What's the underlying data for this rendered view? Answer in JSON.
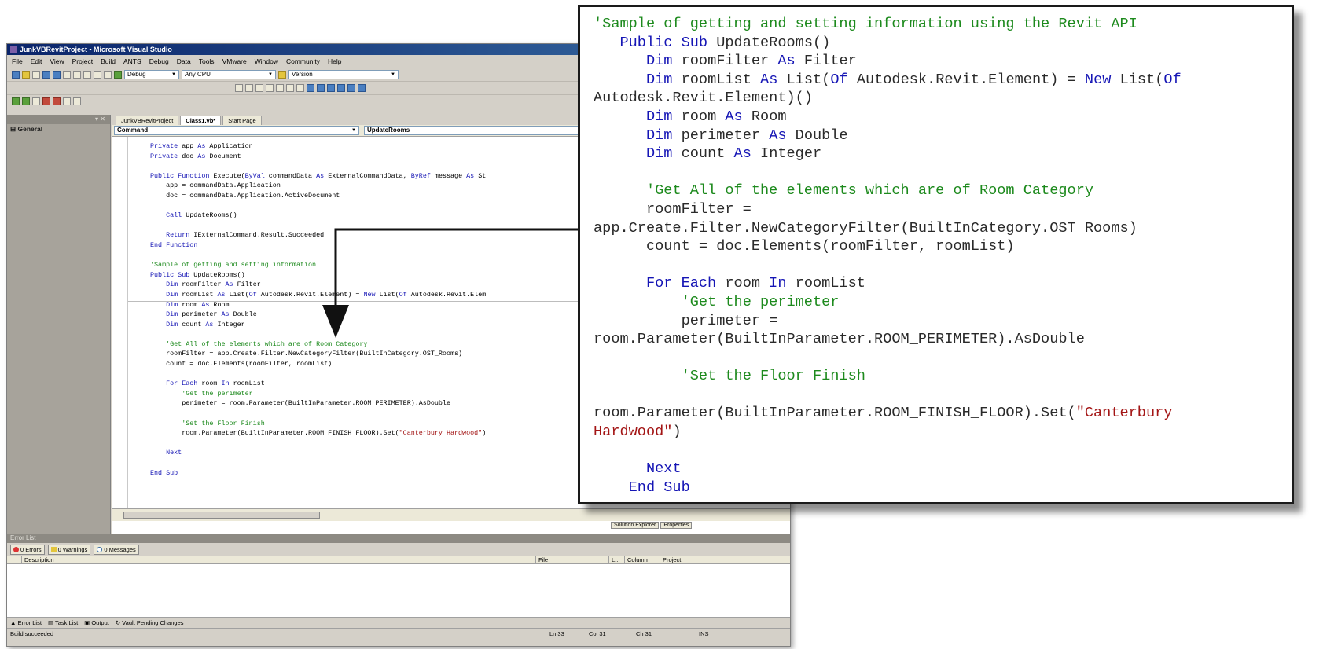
{
  "window": {
    "title": "JunkVBRevitProject - Microsoft Visual Studio"
  },
  "menu": [
    "File",
    "Edit",
    "View",
    "Project",
    "Build",
    "ANTS",
    "Debug",
    "Data",
    "Tools",
    "VMware",
    "Window",
    "Community",
    "Help"
  ],
  "toolbar": {
    "config": "Debug",
    "platform": "Any CPU",
    "version_label": "Version"
  },
  "toolbox": {
    "group": "General"
  },
  "doc_tabs": [
    "JunkVBRevitProject",
    "Class1.vb*",
    "Start Page"
  ],
  "nav": {
    "class_combo": "Command",
    "method_combo": "UpdateRooms"
  },
  "code_lines": [
    {
      "indent": "",
      "parts": [
        {
          "t": "kw",
          "v": "Private"
        },
        {
          "t": "",
          "v": " app "
        },
        {
          "t": "kw",
          "v": "As"
        },
        {
          "t": "",
          "v": " Application"
        }
      ]
    },
    {
      "indent": "",
      "parts": [
        {
          "t": "kw",
          "v": "Private"
        },
        {
          "t": "",
          "v": " doc "
        },
        {
          "t": "kw",
          "v": "As"
        },
        {
          "t": "",
          "v": " Document"
        }
      ]
    },
    {
      "indent": "",
      "parts": []
    },
    {
      "indent": "",
      "parts": [
        {
          "t": "kw",
          "v": "Public Function"
        },
        {
          "t": "",
          "v": " Execute("
        },
        {
          "t": "kw",
          "v": "ByVal"
        },
        {
          "t": "",
          "v": " commandData "
        },
        {
          "t": "kw",
          "v": "As"
        },
        {
          "t": "",
          "v": " ExternalCommandData, "
        },
        {
          "t": "kw",
          "v": "ByRef"
        },
        {
          "t": "",
          "v": " message "
        },
        {
          "t": "kw",
          "v": "As"
        },
        {
          "t": "",
          "v": " St"
        }
      ]
    },
    {
      "indent": "    ",
      "parts": [
        {
          "t": "",
          "v": "app = commandData.Application"
        }
      ]
    },
    {
      "indent": "    ",
      "parts": [
        {
          "t": "",
          "v": "doc = commandData.Application.ActiveDocument"
        }
      ]
    },
    {
      "indent": "",
      "parts": []
    },
    {
      "indent": "    ",
      "parts": [
        {
          "t": "kw",
          "v": "Call"
        },
        {
          "t": "",
          "v": " UpdateRooms()"
        }
      ]
    },
    {
      "indent": "",
      "parts": []
    },
    {
      "indent": "    ",
      "parts": [
        {
          "t": "kw",
          "v": "Return"
        },
        {
          "t": "",
          "v": " IExternalCommand.Result.Succeeded"
        }
      ]
    },
    {
      "indent": "",
      "parts": [
        {
          "t": "kw",
          "v": "End Function"
        }
      ]
    },
    {
      "indent": "",
      "parts": []
    },
    {
      "indent": "",
      "parts": [
        {
          "t": "cm",
          "v": "'Sample of getting and setting information"
        }
      ]
    },
    {
      "indent": "",
      "parts": [
        {
          "t": "kw",
          "v": "Public Sub"
        },
        {
          "t": "",
          "v": " UpdateRooms()"
        }
      ]
    },
    {
      "indent": "    ",
      "parts": [
        {
          "t": "kw",
          "v": "Dim"
        },
        {
          "t": "",
          "v": " roomFilter "
        },
        {
          "t": "kw",
          "v": "As"
        },
        {
          "t": "",
          "v": " Filter"
        }
      ]
    },
    {
      "indent": "    ",
      "parts": [
        {
          "t": "kw",
          "v": "Dim"
        },
        {
          "t": "",
          "v": " roomList "
        },
        {
          "t": "kw",
          "v": "As"
        },
        {
          "t": "",
          "v": " List("
        },
        {
          "t": "kw",
          "v": "Of"
        },
        {
          "t": "",
          "v": " Autodesk.Revit.Element) = "
        },
        {
          "t": "kw",
          "v": "New"
        },
        {
          "t": "",
          "v": " List("
        },
        {
          "t": "kw",
          "v": "Of"
        },
        {
          "t": "",
          "v": " Autodesk.Revit.Elem"
        }
      ]
    },
    {
      "indent": "    ",
      "parts": [
        {
          "t": "kw",
          "v": "Dim"
        },
        {
          "t": "",
          "v": " room "
        },
        {
          "t": "kw",
          "v": "As"
        },
        {
          "t": "",
          "v": " Room"
        }
      ]
    },
    {
      "indent": "    ",
      "parts": [
        {
          "t": "kw",
          "v": "Dim"
        },
        {
          "t": "",
          "v": " perimeter "
        },
        {
          "t": "kw",
          "v": "As"
        },
        {
          "t": "",
          "v": " Double"
        }
      ]
    },
    {
      "indent": "    ",
      "parts": [
        {
          "t": "kw",
          "v": "Dim"
        },
        {
          "t": "",
          "v": " count "
        },
        {
          "t": "kw",
          "v": "As"
        },
        {
          "t": "",
          "v": " Integer"
        }
      ]
    },
    {
      "indent": "",
      "parts": []
    },
    {
      "indent": "    ",
      "parts": [
        {
          "t": "cm",
          "v": "'Get All of the elements which are of Room Category"
        }
      ]
    },
    {
      "indent": "    ",
      "parts": [
        {
          "t": "",
          "v": "roomFilter = app.Create.Filter.NewCategoryFilter(BuiltInCategory.OST_Rooms)"
        }
      ]
    },
    {
      "indent": "    ",
      "parts": [
        {
          "t": "",
          "v": "count = doc.Elements(roomFilter, roomList)"
        }
      ]
    },
    {
      "indent": "",
      "parts": []
    },
    {
      "indent": "    ",
      "parts": [
        {
          "t": "kw",
          "v": "For Each"
        },
        {
          "t": "",
          "v": " room "
        },
        {
          "t": "kw",
          "v": "In"
        },
        {
          "t": "",
          "v": " roomList"
        }
      ]
    },
    {
      "indent": "        ",
      "parts": [
        {
          "t": "cm",
          "v": "'Get the perimeter"
        }
      ]
    },
    {
      "indent": "        ",
      "parts": [
        {
          "t": "",
          "v": "perimeter = room.Parameter(BuiltInParameter.ROOM_PERIMETER).AsDouble"
        }
      ]
    },
    {
      "indent": "",
      "parts": []
    },
    {
      "indent": "        ",
      "parts": [
        {
          "t": "cm",
          "v": "'Set the Floor Finish"
        }
      ]
    },
    {
      "indent": "        ",
      "parts": [
        {
          "t": "",
          "v": "room.Parameter(BuiltInParameter.ROOM_FINISH_FLOOR).Set("
        },
        {
          "t": "st",
          "v": "\"Canterbury Hardwood\""
        },
        {
          "t": "",
          "v": ")"
        }
      ]
    },
    {
      "indent": "",
      "parts": []
    },
    {
      "indent": "    ",
      "parts": [
        {
          "t": "kw",
          "v": "Next"
        }
      ]
    },
    {
      "indent": "",
      "parts": []
    },
    {
      "indent": "",
      "parts": [
        {
          "t": "kw",
          "v": "End Sub"
        }
      ]
    }
  ],
  "callout_lines": [
    {
      "parts": [
        {
          "t": "cm",
          "v": "'Sample of getting and setting information using the Revit API"
        }
      ]
    },
    {
      "parts": [
        {
          "t": "",
          "v": "   "
        },
        {
          "t": "kw",
          "v": "Public Sub"
        },
        {
          "t": "",
          "v": " UpdateRooms()"
        }
      ]
    },
    {
      "parts": [
        {
          "t": "",
          "v": "      "
        },
        {
          "t": "kw",
          "v": "Dim"
        },
        {
          "t": "",
          "v": " roomFilter "
        },
        {
          "t": "kw",
          "v": "As"
        },
        {
          "t": "",
          "v": " Filter"
        }
      ]
    },
    {
      "parts": [
        {
          "t": "",
          "v": "      "
        },
        {
          "t": "kw",
          "v": "Dim"
        },
        {
          "t": "",
          "v": " roomList "
        },
        {
          "t": "kw",
          "v": "As"
        },
        {
          "t": "",
          "v": " List("
        },
        {
          "t": "kw",
          "v": "Of"
        },
        {
          "t": "",
          "v": " Autodesk.Revit.Element) = "
        },
        {
          "t": "kw",
          "v": "New"
        },
        {
          "t": "",
          "v": " List("
        },
        {
          "t": "kw",
          "v": "Of"
        }
      ]
    },
    {
      "parts": [
        {
          "t": "",
          "v": "Autodesk.Revit.Element)()"
        }
      ]
    },
    {
      "parts": [
        {
          "t": "",
          "v": "      "
        },
        {
          "t": "kw",
          "v": "Dim"
        },
        {
          "t": "",
          "v": " room "
        },
        {
          "t": "kw",
          "v": "As"
        },
        {
          "t": "",
          "v": " Room"
        }
      ]
    },
    {
      "parts": [
        {
          "t": "",
          "v": "      "
        },
        {
          "t": "kw",
          "v": "Dim"
        },
        {
          "t": "",
          "v": " perimeter "
        },
        {
          "t": "kw",
          "v": "As"
        },
        {
          "t": "",
          "v": " Double"
        }
      ]
    },
    {
      "parts": [
        {
          "t": "",
          "v": "      "
        },
        {
          "t": "kw",
          "v": "Dim"
        },
        {
          "t": "",
          "v": " count "
        },
        {
          "t": "kw",
          "v": "As"
        },
        {
          "t": "",
          "v": " Integer"
        }
      ]
    },
    {
      "parts": []
    },
    {
      "parts": [
        {
          "t": "",
          "v": "      "
        },
        {
          "t": "cm",
          "v": "'Get All of the elements which are of Room Category"
        }
      ]
    },
    {
      "parts": [
        {
          "t": "",
          "v": "      roomFilter ="
        }
      ]
    },
    {
      "parts": [
        {
          "t": "",
          "v": "app.Create.Filter.NewCategoryFilter(BuiltInCategory.OST_Rooms)"
        }
      ]
    },
    {
      "parts": [
        {
          "t": "",
          "v": "      count = doc.Elements(roomFilter, roomList)"
        }
      ]
    },
    {
      "parts": []
    },
    {
      "parts": [
        {
          "t": "",
          "v": "      "
        },
        {
          "t": "kw",
          "v": "For Each"
        },
        {
          "t": "",
          "v": " room "
        },
        {
          "t": "kw",
          "v": "In"
        },
        {
          "t": "",
          "v": " roomList"
        }
      ]
    },
    {
      "parts": [
        {
          "t": "",
          "v": "          "
        },
        {
          "t": "cm",
          "v": "'Get the perimeter"
        }
      ]
    },
    {
      "parts": [
        {
          "t": "",
          "v": "          perimeter ="
        }
      ]
    },
    {
      "parts": [
        {
          "t": "",
          "v": "room.Parameter(BuiltInParameter.ROOM_PERIMETER).AsDouble"
        }
      ]
    },
    {
      "parts": []
    },
    {
      "parts": [
        {
          "t": "",
          "v": "          "
        },
        {
          "t": "cm",
          "v": "'Set the Floor Finish"
        }
      ]
    },
    {
      "parts": []
    },
    {
      "parts": [
        {
          "t": "",
          "v": "room.Parameter(BuiltInParameter.ROOM_FINISH_FLOOR).Set("
        },
        {
          "t": "st",
          "v": "\"Canterbury"
        }
      ]
    },
    {
      "parts": [
        {
          "t": "st",
          "v": "Hardwood\""
        },
        {
          "t": "",
          "v": ")"
        }
      ]
    },
    {
      "parts": []
    },
    {
      "parts": [
        {
          "t": "",
          "v": "      "
        },
        {
          "t": "kw",
          "v": "Next"
        }
      ]
    },
    {
      "parts": [
        {
          "t": "",
          "v": "    "
        },
        {
          "t": "kw",
          "v": "End Sub"
        }
      ]
    }
  ],
  "error_list": {
    "title": "Error List",
    "errors": "0 Errors",
    "warnings": "0 Warnings",
    "messages": "0 Messages",
    "columns": [
      "Description",
      "File",
      "L...",
      "Column",
      "Project"
    ]
  },
  "bottom_tabs": [
    "Error List",
    "Task List",
    "Output",
    "Vault Pending Changes"
  ],
  "side_tabs": [
    "Solution Explorer",
    "Properties"
  ],
  "status": {
    "message": "Build succeeded",
    "ln": "Ln 33",
    "col": "Col 31",
    "ch": "Ch 31",
    "mode": "INS"
  },
  "colors": {
    "keyword": "#1515b5",
    "comment": "#1d8a1d",
    "string": "#a31515",
    "titlebar": "#0a246a"
  }
}
